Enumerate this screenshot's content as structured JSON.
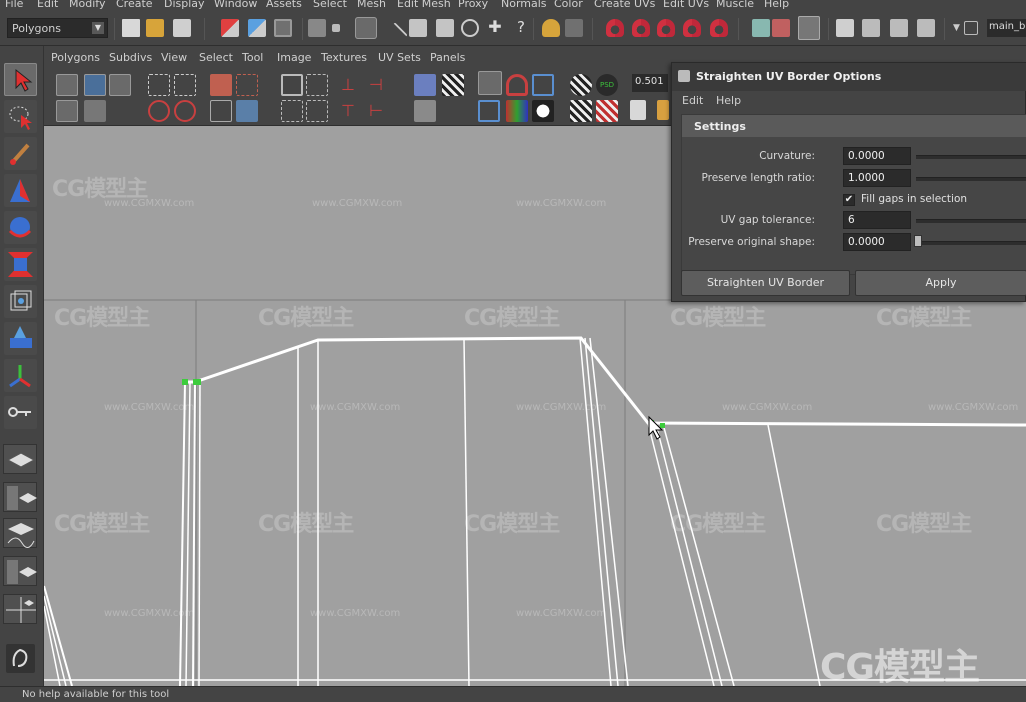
{
  "main_menu": [
    "File",
    "Edit",
    "Modify",
    "Create",
    "Display",
    "Window",
    "Assets",
    "Select",
    "Mesh",
    "Edit Mesh",
    "Proxy",
    "Normals",
    "Color",
    "Create UVs",
    "Edit UVs",
    "Muscle",
    "Help"
  ],
  "status_line": {
    "mode": "Polygons",
    "camera_field": "main_b"
  },
  "uv_editor": {
    "menu": [
      "Polygons",
      "Subdivs",
      "View",
      "Select",
      "Tool",
      "Image",
      "Textures",
      "UV Sets",
      "Panels"
    ],
    "value_field": "0.501"
  },
  "dialog": {
    "title": "Straighten UV Border Options",
    "menu": [
      "Edit",
      "Help"
    ],
    "section": "Settings",
    "curvature": {
      "label": "Curvature:",
      "value": "0.0000"
    },
    "preserve_length_ratio": {
      "label": "Preserve length ratio:",
      "value": "1.0000"
    },
    "fill_gaps": {
      "label": "Fill gaps in selection",
      "checked": true
    },
    "uv_gap_tolerance": {
      "label": "UV gap tolerance:",
      "value": "6"
    },
    "preserve_original_shape": {
      "label": "Preserve original shape:",
      "value": "0.0000"
    },
    "buttons": {
      "primary": "Straighten UV Border",
      "apply": "Apply"
    }
  },
  "help_line": "No help available for this tool",
  "watermark": {
    "text": "CG模型主",
    "url": "www.CGMXW.com"
  },
  "colors": {
    "ui_bg": "#444444",
    "viewport_bg": "#a0a0a0",
    "uv_lines": "#ffffff",
    "selected_vertex": "#3ccc3c",
    "field_bg": "#2b2b2b"
  }
}
